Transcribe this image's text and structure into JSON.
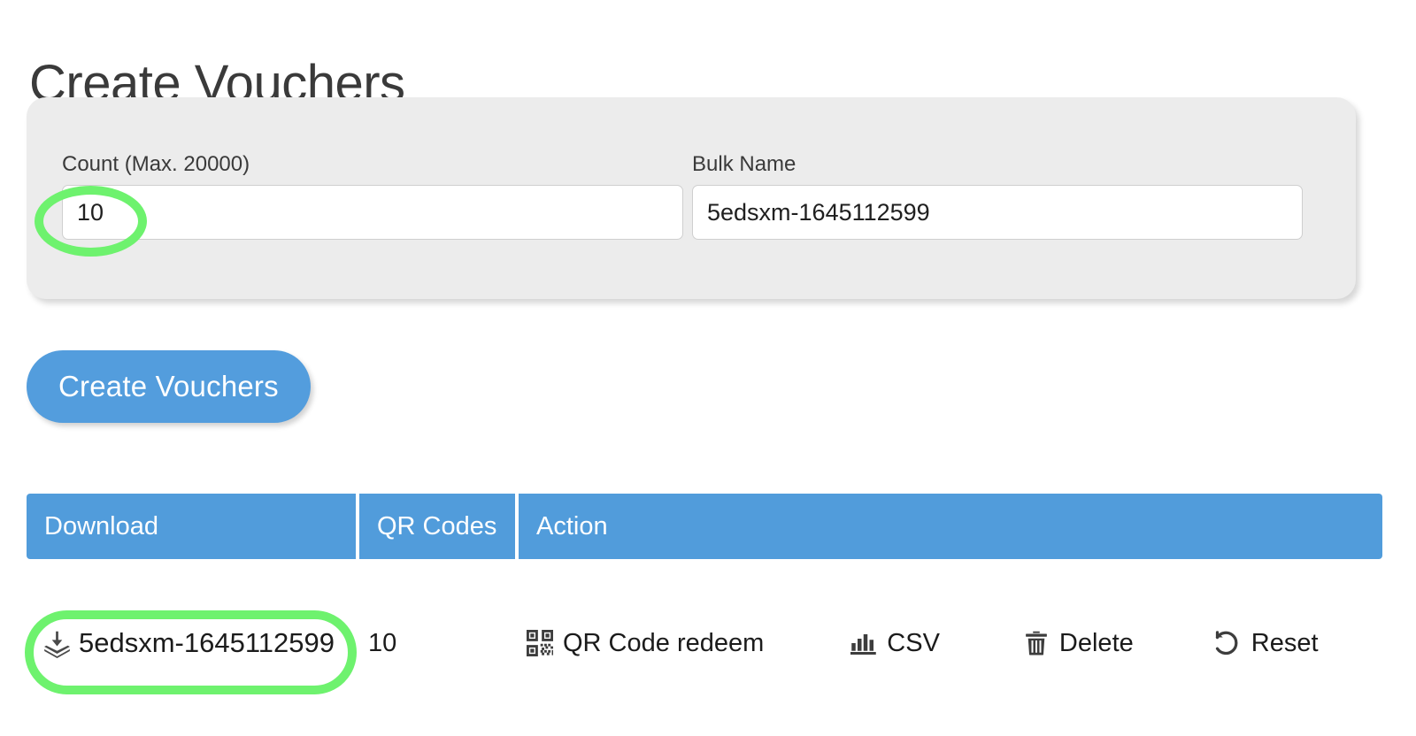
{
  "page": {
    "title": "Create Vouchers"
  },
  "form": {
    "count_field": {
      "label": "Count (Max. 20000)",
      "value": "10",
      "placeholder": "Count"
    },
    "bulk_name_field": {
      "label": "Bulk Name",
      "value": "5edsxm-1645112599",
      "placeholder": "Bulk Name"
    },
    "submit_label": "Create Vouchers"
  },
  "table": {
    "headers": {
      "download": "Download",
      "qr_codes": "QR Codes",
      "action": "Action"
    },
    "rows": [
      {
        "download_icon": "download-icon",
        "download_label": "5edsxm-1645112599",
        "qr_codes_count": "10",
        "actions": [
          {
            "icon": "qr-code-icon",
            "label": "QR Code redeem"
          },
          {
            "icon": "bar-chart-icon",
            "label": "CSV"
          },
          {
            "icon": "trash-icon",
            "label": "Delete"
          },
          {
            "icon": "undo-icon",
            "label": "Reset"
          }
        ]
      }
    ]
  },
  "annotations": [
    {
      "name": "count-input-highlight",
      "shape": "ellipse",
      "color": "#6ef26e"
    },
    {
      "name": "bulk-name-row-highlight",
      "shape": "rounded-rect",
      "color": "#6ef26e"
    }
  ],
  "colors": {
    "accent_blue": "#519cdb",
    "button_blue": "#539ddd",
    "panel_gray": "#ececec",
    "annotation_green": "#6ef26e",
    "text_dark": "#333333"
  }
}
